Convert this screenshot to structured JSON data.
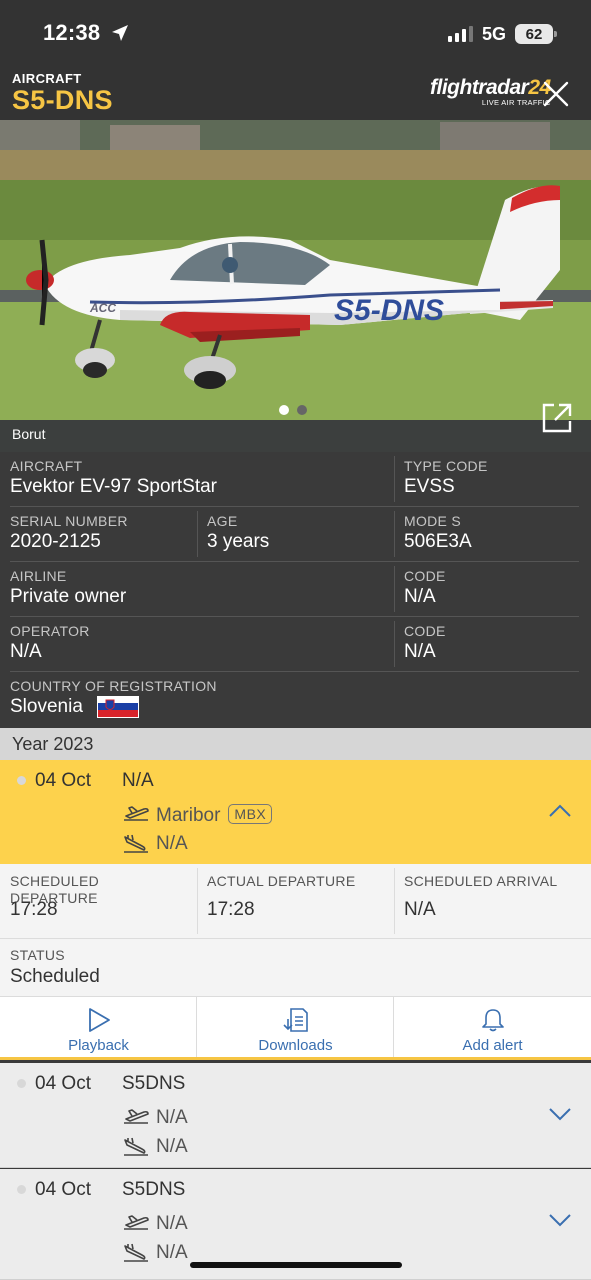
{
  "status_bar": {
    "time": "12:38",
    "network": "5G",
    "battery": "62"
  },
  "header": {
    "caption": "AIRCRAFT",
    "registration": "S5-DNS",
    "brand_name": "flightradar",
    "brand_number": "24",
    "brand_tagline": "LIVE AIR TRAFFIC"
  },
  "photo": {
    "credit": "Borut",
    "livery_text": "S5-DNS",
    "nose_text": "ACC",
    "page_count": 2,
    "current_page": 1
  },
  "details": {
    "aircraft_label": "AIRCRAFT",
    "aircraft_value": "Evektor EV-97 SportStar",
    "type_code_label": "TYPE CODE",
    "type_code_value": "EVSS",
    "serial_label": "SERIAL NUMBER",
    "serial_value": "2020-2125",
    "age_label": "AGE",
    "age_value": "3 years",
    "mode_s_label": "MODE S",
    "mode_s_value": "506E3A",
    "airline_label": "AIRLINE",
    "airline_value": "Private owner",
    "airline_code_label": "CODE",
    "airline_code_value": "N/A",
    "operator_label": "OPERATOR",
    "operator_value": "N/A",
    "operator_code_label": "CODE",
    "operator_code_value": "N/A",
    "country_label": "COUNTRY OF REGISTRATION",
    "country_value": "Slovenia"
  },
  "history": {
    "year_label": "Year 2023",
    "flights": [
      {
        "date": "04 Oct",
        "flight": "N/A",
        "departure": "Maribor",
        "departure_code": "MBX",
        "arrival": "N/A",
        "expanded": true
      },
      {
        "date": "04 Oct",
        "flight": "S5DNS",
        "departure": "N/A",
        "arrival": "N/A",
        "expanded": false
      },
      {
        "date": "04 Oct",
        "flight": "S5DNS",
        "departure": "N/A",
        "arrival": "N/A",
        "expanded": false
      }
    ],
    "detail": {
      "sched_dep_label": "SCHEDULED DEPARTURE",
      "sched_dep_value": "17:28",
      "actual_dep_label": "ACTUAL DEPARTURE",
      "actual_dep_value": "17:28",
      "sched_arr_label": "SCHEDULED ARRIVAL",
      "sched_arr_value": "N/A",
      "status_label": "STATUS",
      "status_value": "Scheduled"
    },
    "actions": [
      {
        "label": "Playback",
        "icon": "play-icon"
      },
      {
        "label": "Downloads",
        "icon": "download-icon"
      },
      {
        "label": "Add alert",
        "icon": "bell-icon"
      }
    ]
  },
  "colors": {
    "accent": "#f6c544",
    "active_row": "#fdd24c",
    "link": "#3a6fb0",
    "panel": "#3a3a3a"
  }
}
